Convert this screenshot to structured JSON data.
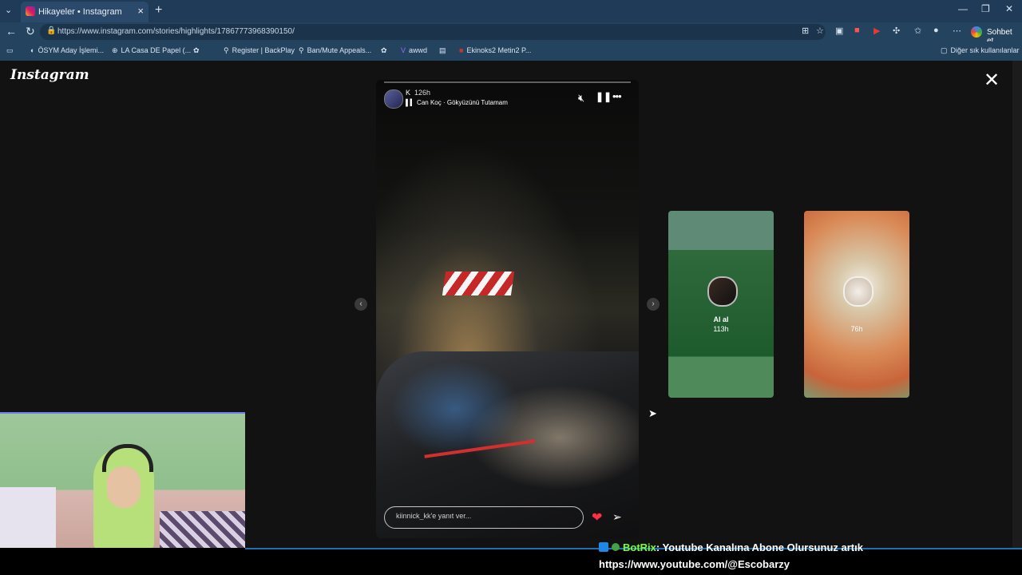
{
  "browser": {
    "tab_title": "Hikayeler • Instagram",
    "url": "https://www.instagram.com/stories/highlights/17867773968390150/",
    "chat_button": "Sohbet et",
    "bookmarks": [
      "ÖSYM Aday İşlemi...",
      "LA Casa DE Papel (...",
      "Register | BackPlay",
      "Ban/Mute Appeals...",
      "awwd",
      "Ekinoks2 Metin2 P..."
    ],
    "other_bookmarks": "Diğer sık kullanılanlar"
  },
  "instagram": {
    "logo": "Instagram",
    "story": {
      "user": "K",
      "time": "126h",
      "music": "Can Koç · Gökyüzünü Tutamam",
      "reply_placeholder": "kiinnick_kk'e yanıt ver..."
    },
    "previews": [
      {
        "name": "Al al",
        "time": "113h"
      },
      {
        "name": "",
        "time": "76h"
      }
    ]
  },
  "overlay": {
    "chat_user": "BotRix",
    "chat_text": ": Youtube Kanalına Abone Olursunuz artık",
    "chat_url": "https://www.youtube.com/@Escobarzy"
  },
  "colors": {
    "browser_chrome": "#23435f",
    "accent_heart": "#ff3040",
    "chat_user": "#7CFC3A"
  },
  "icons": [
    "instagram-icon",
    "close-icon",
    "mute-icon",
    "pause-icon",
    "more-icon",
    "heart-icon",
    "send-icon",
    "chevron-left-icon",
    "chevron-right-icon"
  ]
}
